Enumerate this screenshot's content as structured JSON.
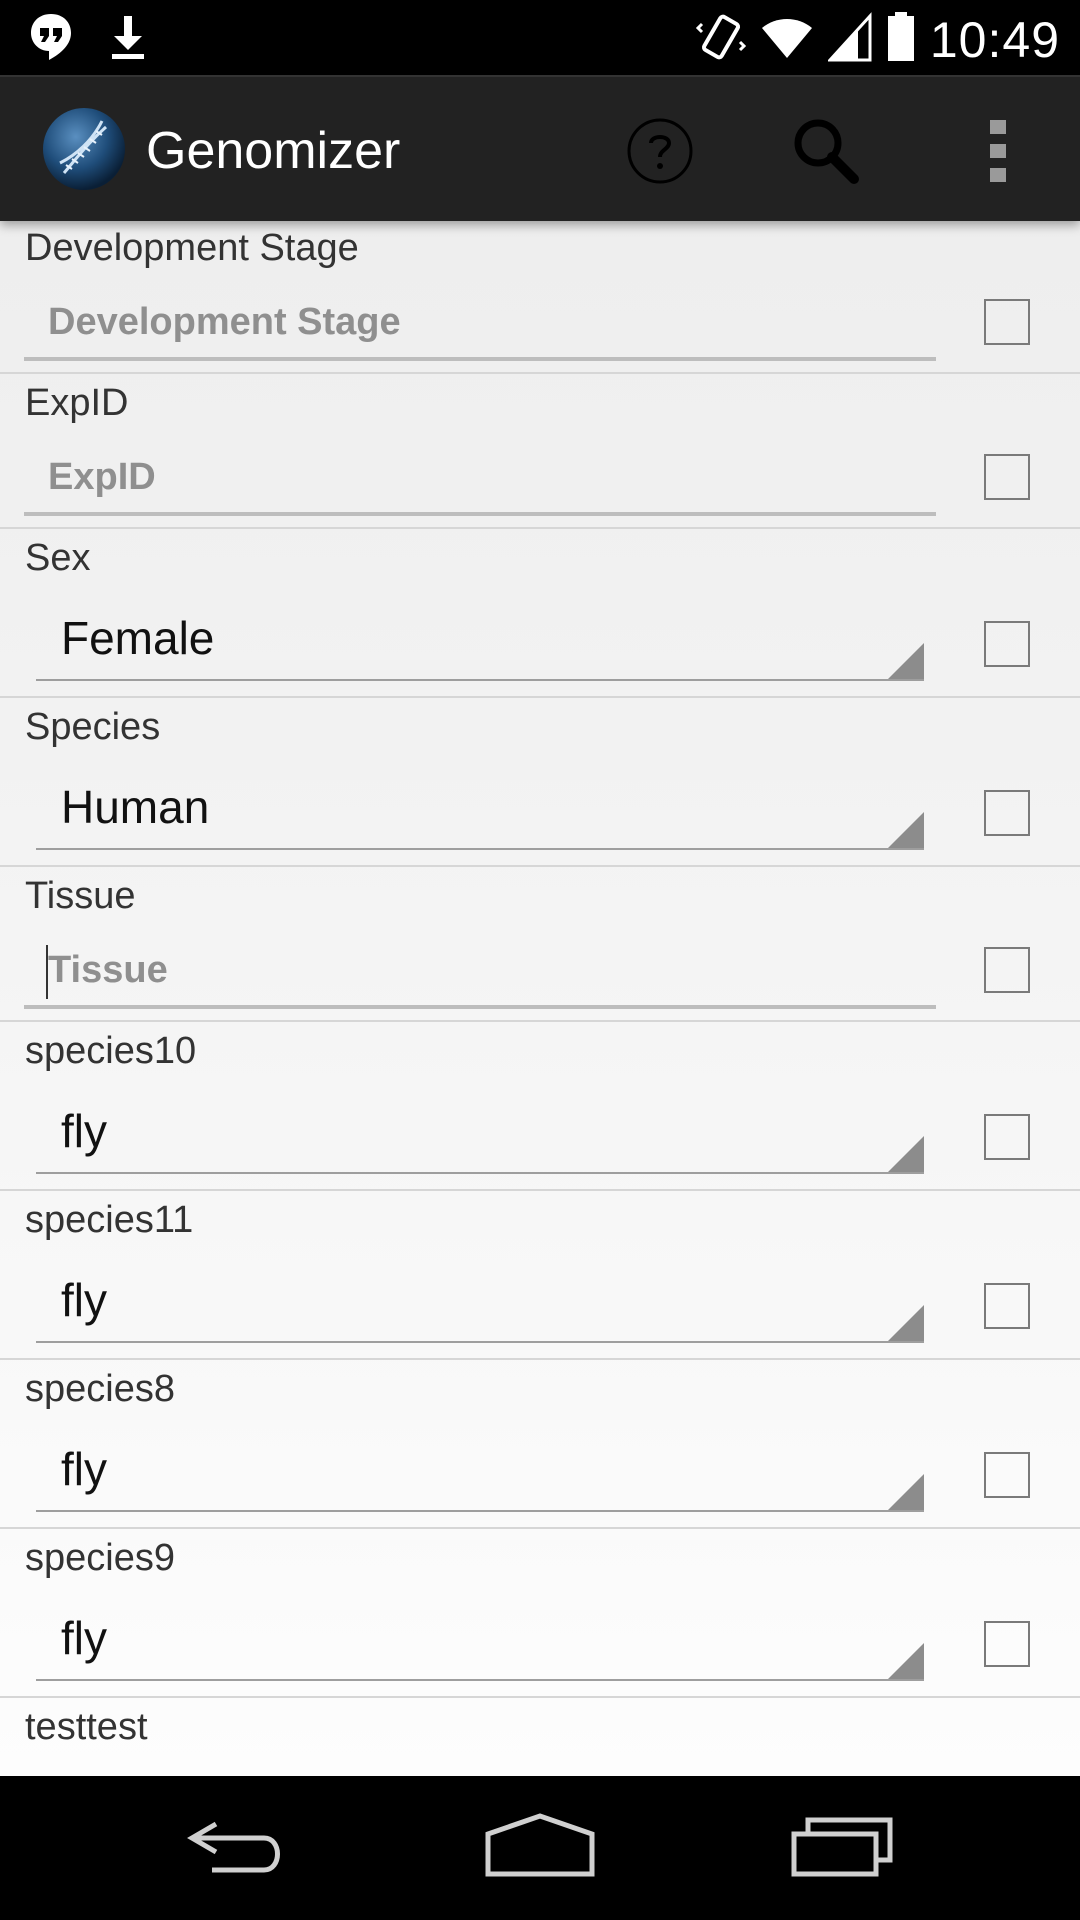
{
  "status_bar": {
    "time": "10:49",
    "left_icons": [
      "hangouts-icon",
      "download-icon"
    ],
    "right_icons": [
      "vibrate-icon",
      "wifi-icon",
      "signal-icon",
      "battery-icon"
    ]
  },
  "action_bar": {
    "title": "Genomizer",
    "logo_icon": "dna-globe-logo",
    "actions": [
      "help-icon",
      "search-icon",
      "overflow-menu-icon"
    ]
  },
  "fields": [
    {
      "label": "Development Stage",
      "type": "text",
      "placeholder": "Development Stage",
      "checked": false
    },
    {
      "label": "ExpID",
      "type": "text",
      "placeholder": "ExpID",
      "checked": false
    },
    {
      "label": "Sex",
      "type": "spinner",
      "value": "Female",
      "checked": false
    },
    {
      "label": "Species",
      "type": "spinner",
      "value": "Human",
      "checked": false
    },
    {
      "label": "Tissue",
      "type": "text",
      "placeholder": "Tissue",
      "focused": true,
      "checked": false
    },
    {
      "label": "species10",
      "type": "spinner",
      "value": "fly",
      "checked": false
    },
    {
      "label": "species11",
      "type": "spinner",
      "value": "fly",
      "checked": false
    },
    {
      "label": "species8",
      "type": "spinner",
      "value": "fly",
      "checked": false
    },
    {
      "label": "species9",
      "type": "spinner",
      "value": "fly",
      "checked": false
    },
    {
      "label": "testtest",
      "type": "partial"
    }
  ],
  "nav_bar": {
    "buttons": [
      "back-icon",
      "home-icon",
      "recents-icon"
    ]
  }
}
